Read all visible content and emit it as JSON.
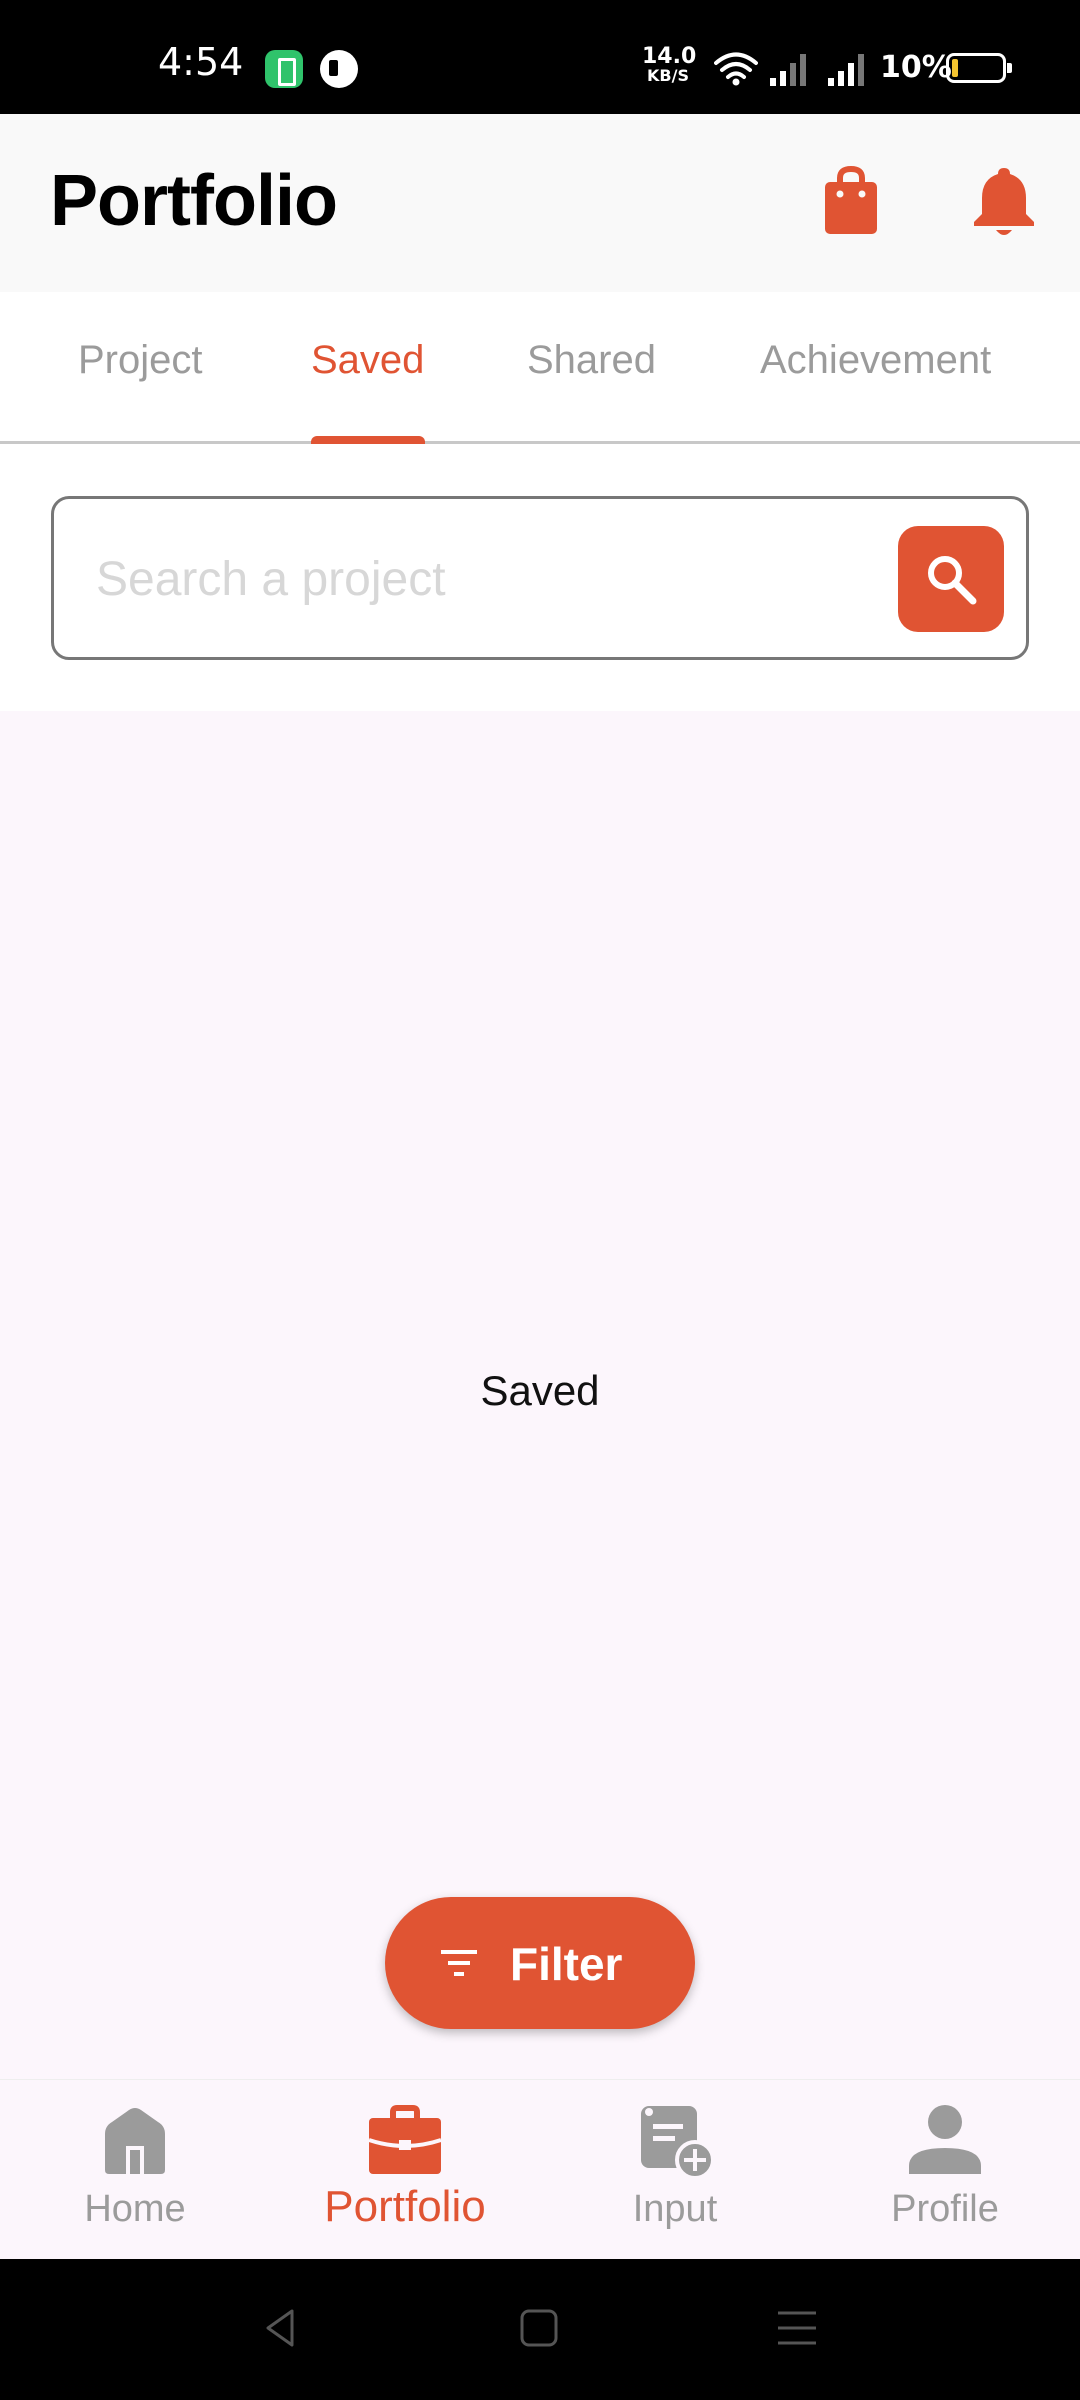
{
  "status_bar": {
    "time": "4:54",
    "net_speed_value": "14.0",
    "net_speed_unit": "KB/S",
    "battery_percent": "10%"
  },
  "header": {
    "title": "Portfolio",
    "icons": [
      "shopping-bag-icon",
      "bell-icon"
    ]
  },
  "tabs": [
    {
      "label": "Project",
      "active": false
    },
    {
      "label": "Saved",
      "active": true
    },
    {
      "label": "Shared",
      "active": false
    },
    {
      "label": "Achievement",
      "active": false
    }
  ],
  "search": {
    "placeholder": "Search a project",
    "value": "",
    "button_icon": "search-icon"
  },
  "main": {
    "empty_label": "Saved"
  },
  "filter": {
    "label": "Filter",
    "icon": "filter-icon"
  },
  "bottom_nav": [
    {
      "label": "Home",
      "icon": "home-icon",
      "active": false
    },
    {
      "label": "Portfolio",
      "icon": "briefcase-icon",
      "active": true
    },
    {
      "label": "Input",
      "icon": "add-document-icon",
      "active": false
    },
    {
      "label": "Profile",
      "icon": "person-icon",
      "active": false
    }
  ],
  "colors": {
    "accent": "#e05433",
    "inactive": "#9b9b9b",
    "background": "#fcf6fc"
  }
}
